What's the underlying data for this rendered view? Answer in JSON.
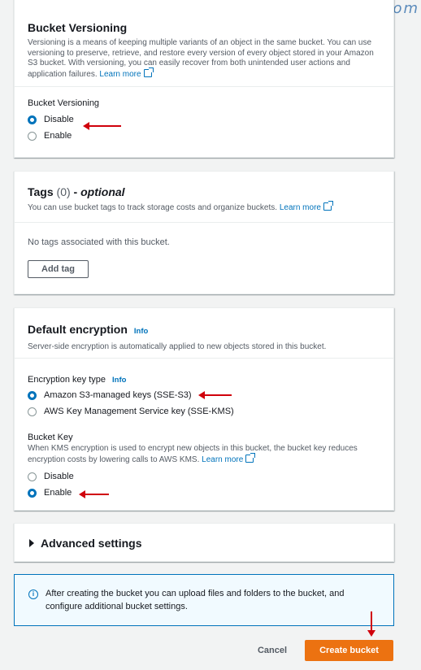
{
  "watermark": "ARAHDEV.com",
  "versioning": {
    "title": "Bucket Versioning",
    "description": "Versioning is a means of keeping multiple variants of an object in the same bucket. You can use versioning to preserve, retrieve, and restore every version of every object stored in your Amazon S3 bucket. With versioning, you can easily recover from both unintended user actions and application failures.",
    "learn_more": "Learn more",
    "field_label": "Bucket Versioning",
    "options": [
      {
        "label": "Disable",
        "checked": true
      },
      {
        "label": "Enable",
        "checked": false
      }
    ]
  },
  "tags": {
    "title": "Tags",
    "count": "(0)",
    "dash": " - ",
    "optional": "optional",
    "description": "You can use bucket tags to track storage costs and organize buckets.",
    "learn_more": "Learn more",
    "empty_text": "No tags associated with this bucket.",
    "add_tag": "Add tag"
  },
  "encryption": {
    "title": "Default encryption",
    "info": "Info",
    "description": "Server-side encryption is automatically applied to new objects stored in this bucket.",
    "key_type_label": "Encryption key type",
    "key_type_info": "Info",
    "key_type_options": [
      {
        "label": "Amazon S3-managed keys (SSE-S3)",
        "checked": true
      },
      {
        "label": "AWS Key Management Service key (SSE-KMS)",
        "checked": false
      }
    ],
    "bucket_key_label": "Bucket Key",
    "bucket_key_description": "When KMS encryption is used to encrypt new objects in this bucket, the bucket key reduces encryption costs by lowering calls to AWS KMS.",
    "bucket_key_learn_more": "Learn more",
    "bucket_key_options": [
      {
        "label": "Disable",
        "checked": false
      },
      {
        "label": "Enable",
        "checked": true
      }
    ]
  },
  "advanced": {
    "title": "Advanced settings"
  },
  "alert": {
    "icon": "info-icon",
    "text": "After creating the bucket you can upload files and folders to the bucket, and configure additional bucket settings."
  },
  "footer": {
    "cancel": "Cancel",
    "create": "Create bucket"
  },
  "colors": {
    "accent": "#0073bb",
    "primary_button": "#ec7211",
    "annotation_arrow": "#d0000b"
  }
}
